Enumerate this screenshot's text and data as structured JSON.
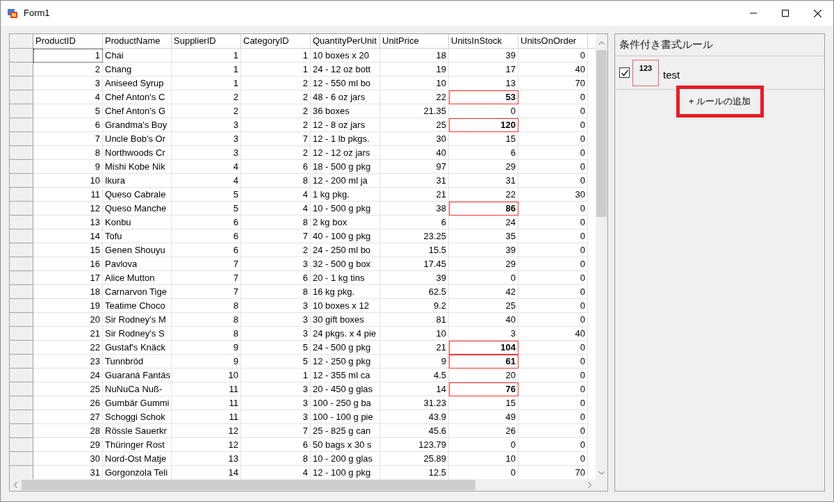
{
  "window": {
    "title": "Form1"
  },
  "grid": {
    "columns": [
      {
        "label": "ProductID",
        "kind": "number"
      },
      {
        "label": "ProductName",
        "kind": "text"
      },
      {
        "label": "SupplierID",
        "kind": "number"
      },
      {
        "label": "CategoryID",
        "kind": "number"
      },
      {
        "label": "QuantityPerUnit",
        "kind": "text"
      },
      {
        "label": "UnitPrice",
        "kind": "number"
      },
      {
        "label": "UnitsInStock",
        "kind": "number"
      },
      {
        "label": "UnitsOnOrder",
        "kind": "number"
      }
    ],
    "rows": [
      {
        "cells": [
          "1",
          "Chai",
          "1",
          "1",
          "10 boxes x 20",
          "18",
          "39",
          "0"
        ],
        "focused": true,
        "highlighted": false
      },
      {
        "cells": [
          "2",
          "Chang",
          "1",
          "1",
          "24 - 12 oz bott",
          "19",
          "17",
          "40"
        ],
        "focused": false,
        "highlighted": false
      },
      {
        "cells": [
          "3",
          "Aniseed Syrup",
          "1",
          "2",
          "12 - 550 ml bo",
          "10",
          "13",
          "70"
        ],
        "focused": false,
        "highlighted": false
      },
      {
        "cells": [
          "4",
          "Chef Anton's C",
          "2",
          "2",
          "48 - 6 oz jars",
          "22",
          "53",
          "0"
        ],
        "focused": false,
        "highlighted": true
      },
      {
        "cells": [
          "5",
          "Chef Anton's G",
          "2",
          "2",
          "36 boxes",
          "21.35",
          "0",
          "0"
        ],
        "focused": false,
        "highlighted": false
      },
      {
        "cells": [
          "6",
          "Grandma's Boy",
          "3",
          "2",
          "12 - 8 oz jars",
          "25",
          "120",
          "0"
        ],
        "focused": false,
        "highlighted": true
      },
      {
        "cells": [
          "7",
          "Uncle Bob's Or",
          "3",
          "7",
          "12 - 1 lb pkgs.",
          "30",
          "15",
          "0"
        ],
        "focused": false,
        "highlighted": false
      },
      {
        "cells": [
          "8",
          "Northwoods Cr",
          "3",
          "2",
          "12 - 12 oz jars",
          "40",
          "6",
          "0"
        ],
        "focused": false,
        "highlighted": false
      },
      {
        "cells": [
          "9",
          "Mishi Kobe Nik",
          "4",
          "6",
          "18 - 500 g pkg",
          "97",
          "29",
          "0"
        ],
        "focused": false,
        "highlighted": false
      },
      {
        "cells": [
          "10",
          "Ikura",
          "4",
          "8",
          "12 - 200 ml ja",
          "31",
          "31",
          "0"
        ],
        "focused": false,
        "highlighted": false
      },
      {
        "cells": [
          "11",
          "Queso Cabrale",
          "5",
          "4",
          "1 kg pkg.",
          "21",
          "22",
          "30"
        ],
        "focused": false,
        "highlighted": false
      },
      {
        "cells": [
          "12",
          "Queso Manche",
          "5",
          "4",
          "10 - 500 g pkg",
          "38",
          "86",
          "0"
        ],
        "focused": false,
        "highlighted": true
      },
      {
        "cells": [
          "13",
          "Konbu",
          "6",
          "8",
          "2 kg box",
          "6",
          "24",
          "0"
        ],
        "focused": false,
        "highlighted": false
      },
      {
        "cells": [
          "14",
          "Tofu",
          "6",
          "7",
          "40 - 100 g pkg",
          "23.25",
          "35",
          "0"
        ],
        "focused": false,
        "highlighted": false
      },
      {
        "cells": [
          "15",
          "Genen Shouyu",
          "6",
          "2",
          "24 - 250 ml bo",
          "15.5",
          "39",
          "0"
        ],
        "focused": false,
        "highlighted": false
      },
      {
        "cells": [
          "16",
          "Pavlova",
          "7",
          "3",
          "32 - 500 g box",
          "17.45",
          "29",
          "0"
        ],
        "focused": false,
        "highlighted": false
      },
      {
        "cells": [
          "17",
          "Alice Mutton",
          "7",
          "6",
          "20 - 1 kg tins",
          "39",
          "0",
          "0"
        ],
        "focused": false,
        "highlighted": false
      },
      {
        "cells": [
          "18",
          "Carnarvon Tige",
          "7",
          "8",
          "16 kg pkg.",
          "62.5",
          "42",
          "0"
        ],
        "focused": false,
        "highlighted": false
      },
      {
        "cells": [
          "19",
          "Teatime Choco",
          "8",
          "3",
          "10 boxes x 12",
          "9.2",
          "25",
          "0"
        ],
        "focused": false,
        "highlighted": false
      },
      {
        "cells": [
          "20",
          "Sir Rodney's M",
          "8",
          "3",
          "30 gift boxes",
          "81",
          "40",
          "0"
        ],
        "focused": false,
        "highlighted": false
      },
      {
        "cells": [
          "21",
          "Sir Rodney's S",
          "8",
          "3",
          "24 pkgs. x 4 pie",
          "10",
          "3",
          "40"
        ],
        "focused": false,
        "highlighted": false
      },
      {
        "cells": [
          "22",
          "Gustaf's Knäck",
          "9",
          "5",
          "24 - 500 g pkg",
          "21",
          "104",
          "0"
        ],
        "focused": false,
        "highlighted": true
      },
      {
        "cells": [
          "23",
          "Tunnbröd",
          "9",
          "5",
          "12 - 250 g pkg",
          "9",
          "61",
          "0"
        ],
        "focused": false,
        "highlighted": true
      },
      {
        "cells": [
          "24",
          "Guaraná Fantás",
          "10",
          "1",
          "12 - 355 ml ca",
          "4.5",
          "20",
          "0"
        ],
        "focused": false,
        "highlighted": false
      },
      {
        "cells": [
          "25",
          "NuNuCa Nuß-",
          "11",
          "3",
          "20 - 450 g glas",
          "14",
          "76",
          "0"
        ],
        "focused": false,
        "highlighted": true
      },
      {
        "cells": [
          "26",
          "Gumbär Gummi",
          "11",
          "3",
          "100 - 250 g ba",
          "31.23",
          "15",
          "0"
        ],
        "focused": false,
        "highlighted": false
      },
      {
        "cells": [
          "27",
          "Schoggi Schok",
          "11",
          "3",
          "100 - 100 g pie",
          "43.9",
          "49",
          "0"
        ],
        "focused": false,
        "highlighted": false
      },
      {
        "cells": [
          "28",
          "Rössle Sauerkr",
          "12",
          "7",
          "25 - 825 g can",
          "45.6",
          "26",
          "0"
        ],
        "focused": false,
        "highlighted": false
      },
      {
        "cells": [
          "29",
          "Thüringer Rost",
          "12",
          "6",
          "50 bags x 30 s",
          "123.79",
          "0",
          "0"
        ],
        "focused": false,
        "highlighted": false
      },
      {
        "cells": [
          "30",
          "Nord-Ost Matje",
          "13",
          "8",
          "10 - 200 g glas",
          "25.89",
          "10",
          "0"
        ],
        "focused": false,
        "highlighted": false
      },
      {
        "cells": [
          "31",
          "Gorgonzola Teli",
          "14",
          "4",
          "12 - 100 g pkg",
          "12.5",
          "0",
          "70"
        ],
        "focused": false,
        "highlighted": false
      }
    ]
  },
  "rules_panel": {
    "title": "条件付き書式ルール",
    "rules": [
      {
        "checked": true,
        "sample": "123",
        "name": "test"
      }
    ],
    "add_button": "+ ルールの追加"
  }
}
